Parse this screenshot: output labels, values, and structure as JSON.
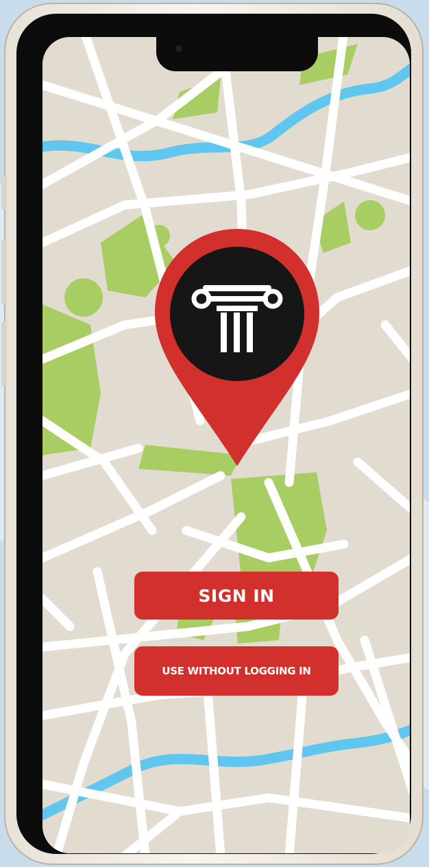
{
  "screen": {
    "sign_in_label": "SIGN IN",
    "guest_label": "USE WITHOUT LOGGING IN"
  },
  "icons": {
    "pin": "map-pin-icon",
    "logo": "column-logo-icon"
  },
  "colors": {
    "accent": "#d1302c",
    "map_land": "#e2dbcf",
    "map_road": "#ffffff",
    "map_park": "#a8cd62",
    "map_river": "#5ec6ef",
    "logo_background": "#161616"
  }
}
